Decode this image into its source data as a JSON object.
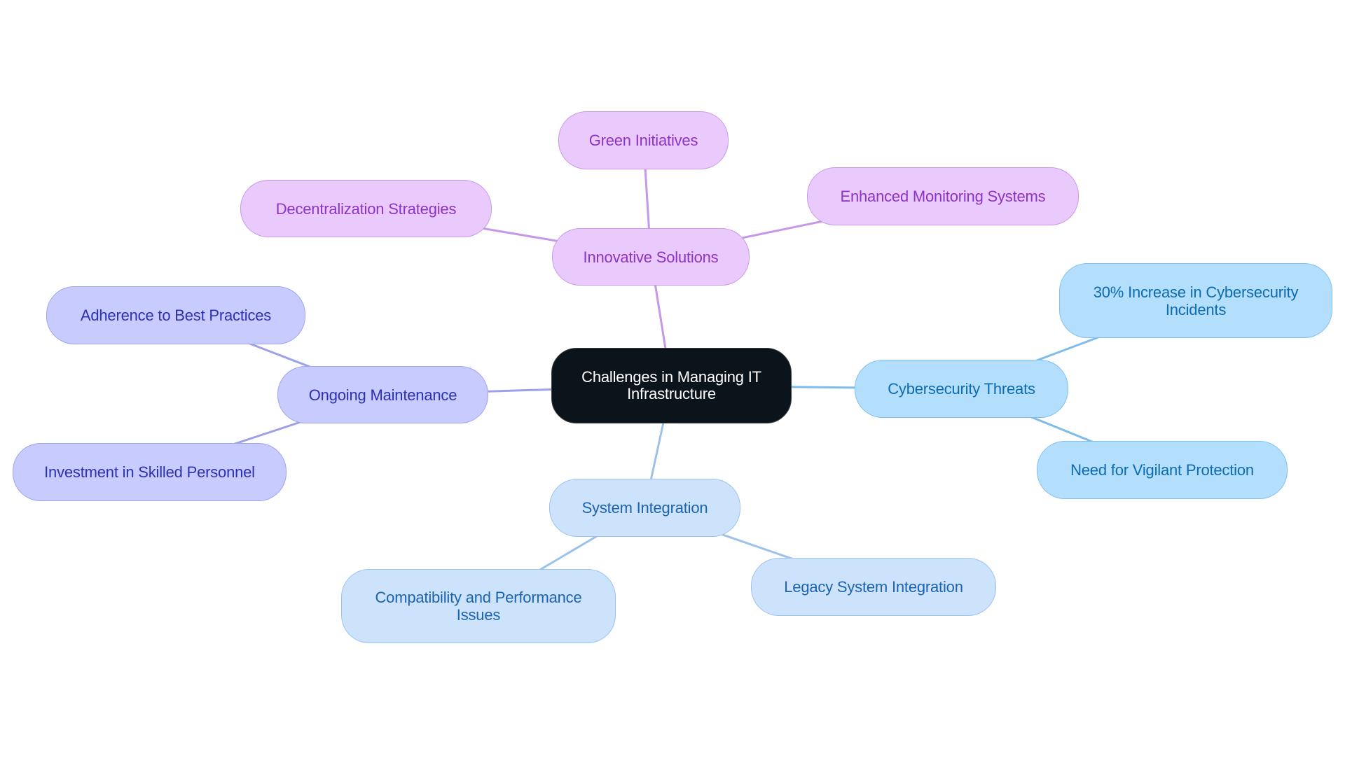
{
  "title": "Challenges in Managing IT Infrastructure",
  "palette": {
    "root": {
      "fill": "#0c141b",
      "stroke": "#3a3f44",
      "text": "#ffffff"
    },
    "purple": {
      "fill": "#eacafc",
      "stroke": "#c79be8",
      "text": "#8c34c4",
      "edge": "#c597e8"
    },
    "indigo": {
      "fill": "#c8cbfd",
      "stroke": "#9fa5ee",
      "text": "#2d31b0",
      "edge": "#9ca1ea"
    },
    "sky": {
      "fill": "#b3defc",
      "stroke": "#84c0ef",
      "text": "#0d6bb1",
      "edge": "#7fbcea"
    },
    "pale": {
      "fill": "#cde3fb",
      "stroke": "#9cc3ee",
      "text": "#1b63b0",
      "edge": "#9dc2ea"
    }
  },
  "nodes": [
    {
      "id": "root",
      "label": "Challenges in Managing IT Infrastructure",
      "group": "root",
      "parent": null
    },
    {
      "id": "innovative",
      "label": "Innovative Solutions",
      "group": "purple",
      "parent": "root"
    },
    {
      "id": "green",
      "label": "Green Initiatives",
      "group": "purple",
      "parent": "innovative"
    },
    {
      "id": "decentral",
      "label": "Decentralization Strategies",
      "group": "purple",
      "parent": "innovative"
    },
    {
      "id": "monitoring",
      "label": "Enhanced Monitoring Systems",
      "group": "purple",
      "parent": "innovative"
    },
    {
      "id": "maintenance",
      "label": "Ongoing Maintenance",
      "group": "indigo",
      "parent": "root"
    },
    {
      "id": "adherence",
      "label": "Adherence to Best Practices",
      "group": "indigo",
      "parent": "maintenance"
    },
    {
      "id": "investment",
      "label": "Investment in Skilled Personnel",
      "group": "indigo",
      "parent": "maintenance"
    },
    {
      "id": "cyber",
      "label": "Cybersecurity Threats",
      "group": "sky",
      "parent": "root"
    },
    {
      "id": "increase",
      "label": "30% Increase in Cybersecurity Incidents",
      "group": "sky",
      "parent": "cyber"
    },
    {
      "id": "vigilant",
      "label": "Need for Vigilant Protection",
      "group": "sky",
      "parent": "cyber"
    },
    {
      "id": "sysint",
      "label": "System Integration",
      "group": "pale",
      "parent": "root"
    },
    {
      "id": "compat",
      "label": "Compatibility and Performance Issues",
      "group": "pale",
      "parent": "sysint"
    },
    {
      "id": "legacy",
      "label": "Legacy System Integration",
      "group": "pale",
      "parent": "sysint"
    }
  ]
}
